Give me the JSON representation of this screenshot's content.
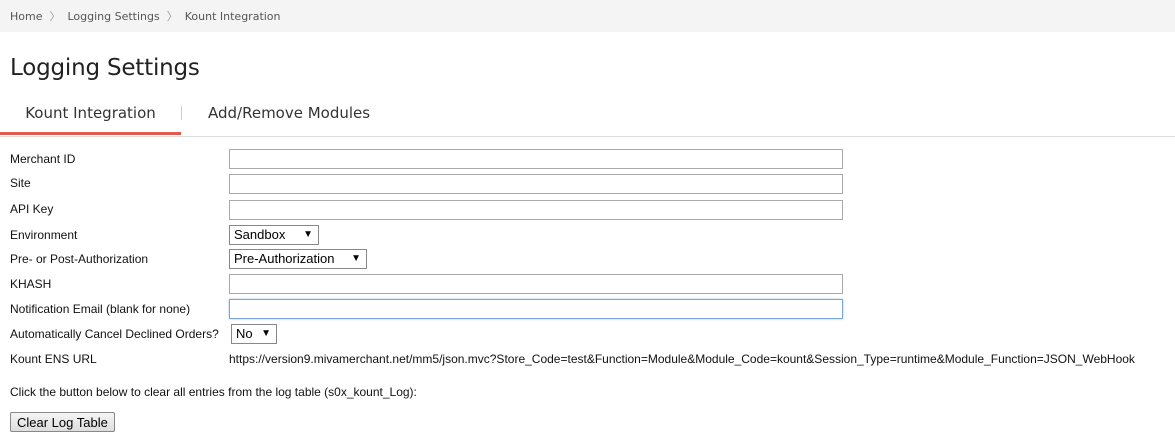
{
  "breadcrumb": {
    "items": [
      "Home",
      "Logging Settings",
      "Kount Integration"
    ],
    "separator": "〉"
  },
  "page": {
    "title": "Logging Settings"
  },
  "tabs": [
    {
      "label": "Kount Integration",
      "active": true
    },
    {
      "label": "Add/Remove Modules",
      "active": false
    }
  ],
  "form": {
    "merchant_id": {
      "label": "Merchant ID",
      "value": ""
    },
    "site": {
      "label": "Site",
      "value": ""
    },
    "api_key": {
      "label": "API Key",
      "value": ""
    },
    "environment": {
      "label": "Environment",
      "selected": "Sandbox"
    },
    "authorization": {
      "label": "Pre- or Post-Authorization",
      "selected": "Pre-Authorization"
    },
    "khash": {
      "label": "KHASH",
      "value": ""
    },
    "notification_email": {
      "label": "Notification Email (blank for none)",
      "value": ""
    },
    "auto_cancel": {
      "label": "Automatically Cancel Declined Orders?",
      "selected": "No"
    },
    "ens_url": {
      "label": "Kount ENS URL",
      "value": "https://version9.mivamerchant.net/mm5/json.mvc?Store_Code=test&Function=Module&Module_Code=kount&Session_Type=runtime&Module_Function=JSON_WebHook"
    }
  },
  "log": {
    "info_text": "Click the button below to clear all entries from the log table (s0x_kount_Log):",
    "clear_button_label": "Clear Log Table"
  },
  "icons": {
    "dropdown_arrow": "▼"
  },
  "colors": {
    "active_tab_underline": "#e05a4e",
    "breadcrumb_bg": "#f4f4f4"
  }
}
